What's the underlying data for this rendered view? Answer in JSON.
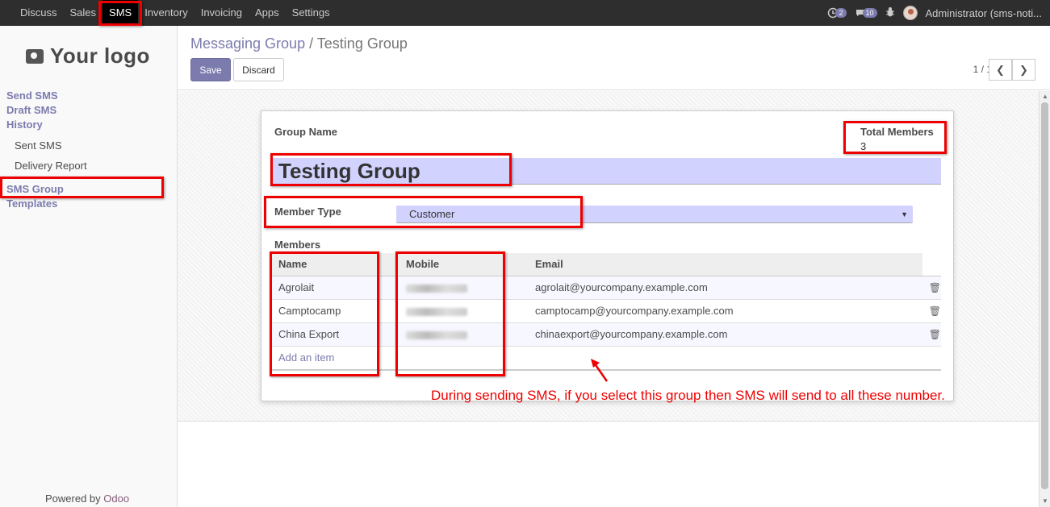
{
  "topbar": {
    "menu": [
      "Discuss",
      "Sales",
      "SMS",
      "Inventory",
      "Invoicing",
      "Apps",
      "Settings"
    ],
    "active_menu": "SMS",
    "activity_count": "2",
    "message_count": "10",
    "user": "Administrator (sms-noti..."
  },
  "sidebar": {
    "logo_text": "Your logo",
    "items": {
      "send_sms": "Send SMS",
      "draft_sms": "Draft SMS",
      "history": "History",
      "sent_sms": "Sent SMS",
      "delivery_report": "Delivery Report",
      "sms_group": "SMS Group",
      "templates": "Templates"
    },
    "powered_by": "Powered by",
    "powered_brand": "Odoo"
  },
  "control_panel": {
    "breadcrumb_parent": "Messaging Group",
    "breadcrumb_sep": "/",
    "breadcrumb_current": "Testing Group",
    "save_label": "Save",
    "discard_label": "Discard",
    "pager": "1 / 1"
  },
  "form": {
    "group_name_label": "Group Name",
    "group_name_value": "Testing Group",
    "total_members_label": "Total Members",
    "total_members_value": "3",
    "member_type_label": "Member Type",
    "member_type_value": "Customer",
    "members_label": "Members",
    "columns": [
      "Name",
      "Mobile",
      "Email"
    ],
    "rows": [
      {
        "name": "Agrolait",
        "email": "agrolait@yourcompany.example.com"
      },
      {
        "name": "Camptocamp",
        "email": "camptocamp@yourcompany.example.com"
      },
      {
        "name": "China Export",
        "email": "chinaexport@yourcompany.example.com"
      }
    ],
    "add_item": "Add an item"
  },
  "annotation": "During sending SMS, if you select this group then SMS will send to all these number.",
  "colors": {
    "accent": "#7c7bad",
    "annotation_red": "#ee0000",
    "topbar": "#2e2e2e"
  }
}
